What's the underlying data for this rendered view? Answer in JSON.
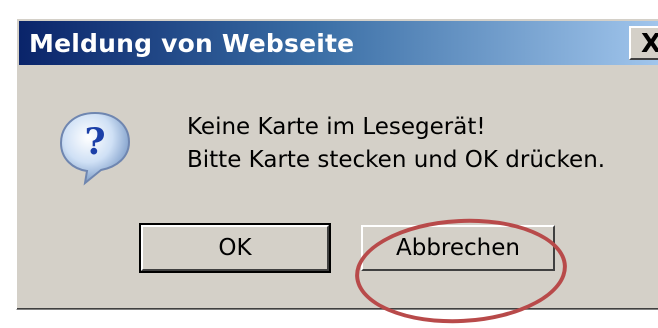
{
  "dialog": {
    "title": "Meldung von Webseite",
    "close_label": "X",
    "icon": "question-mark-icon",
    "message_line1": "Keine Karte im Lesegerät!",
    "message_line2": "Bitte Karte stecken und OK drücken.",
    "ok_label": "OK",
    "cancel_label": "Abbrechen"
  },
  "colors": {
    "title_gradient_start": "#0a246a",
    "title_gradient_end": "#a6caf0",
    "dialog_bg": "#d4d0c8",
    "annotation_circle": "#b84a4a"
  }
}
